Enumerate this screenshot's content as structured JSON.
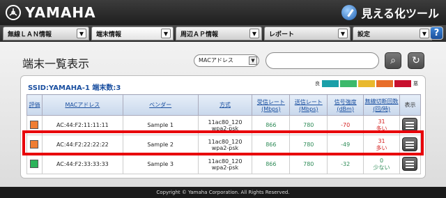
{
  "brand": {
    "name": "YAMAHA",
    "tool": "見える化ツール"
  },
  "tabs": [
    {
      "label": "無線ＬＡＮ情報",
      "w": 124
    },
    {
      "label": "端末情報",
      "w": 118
    },
    {
      "label": "周辺ＡＰ情報",
      "w": 124
    },
    {
      "label": "レポート",
      "w": 124
    },
    {
      "label": "設定",
      "w": 114
    }
  ],
  "help": "?",
  "page": {
    "title": "端末一覧表示",
    "select_value": "MACアドレス",
    "search_placeholder": ""
  },
  "ssid_label": "SSID:YAMAHA-1 端末数:3",
  "legend": {
    "good": "良",
    "bad": "悪",
    "colors": [
      "#1a9fa8",
      "#3cb96b",
      "#e9b92e",
      "#e86e2a",
      "#c8102e"
    ]
  },
  "table": {
    "headers": [
      "評価",
      "MACアドレス",
      "ベンダー",
      "方式",
      "受信レート (Mbps)",
      "送信レート (Mbps)",
      "信号強度 (dBm)",
      "無線切断回数 (回/時)",
      "表示"
    ],
    "rows": [
      {
        "color": "#ef7d32",
        "mac": "AC:44:F2:11:11:11",
        "vendor": "Sample 1",
        "mode1": "11ac80_120",
        "mode2": "wpa2-psk",
        "rx": "866",
        "tx": "780",
        "signal": "-70",
        "signal_class": "red",
        "disc": "31",
        "disc_label": "多い",
        "disc_class": "red"
      },
      {
        "color": "#ef7d32",
        "mac": "AC:44:F2:22:22:22",
        "vendor": "Sample 2",
        "mode1": "11ac80_120",
        "mode2": "wpa2-psk",
        "rx": "866",
        "tx": "780",
        "signal": "-49",
        "signal_class": "green",
        "disc": "31",
        "disc_label": "多い",
        "disc_class": "red"
      },
      {
        "color": "#2db35a",
        "mac": "AC:44:F2:33:33:33",
        "vendor": "Sample 3",
        "mode1": "11ac80_120",
        "mode2": "wpa2-psk",
        "rx": "866",
        "tx": "780",
        "signal": "-32",
        "signal_class": "green",
        "disc": "0",
        "disc_label": "少ない",
        "disc_class": "green"
      }
    ]
  },
  "footer": "Copyright © Yamaha Corporation. All Rights Reserved."
}
